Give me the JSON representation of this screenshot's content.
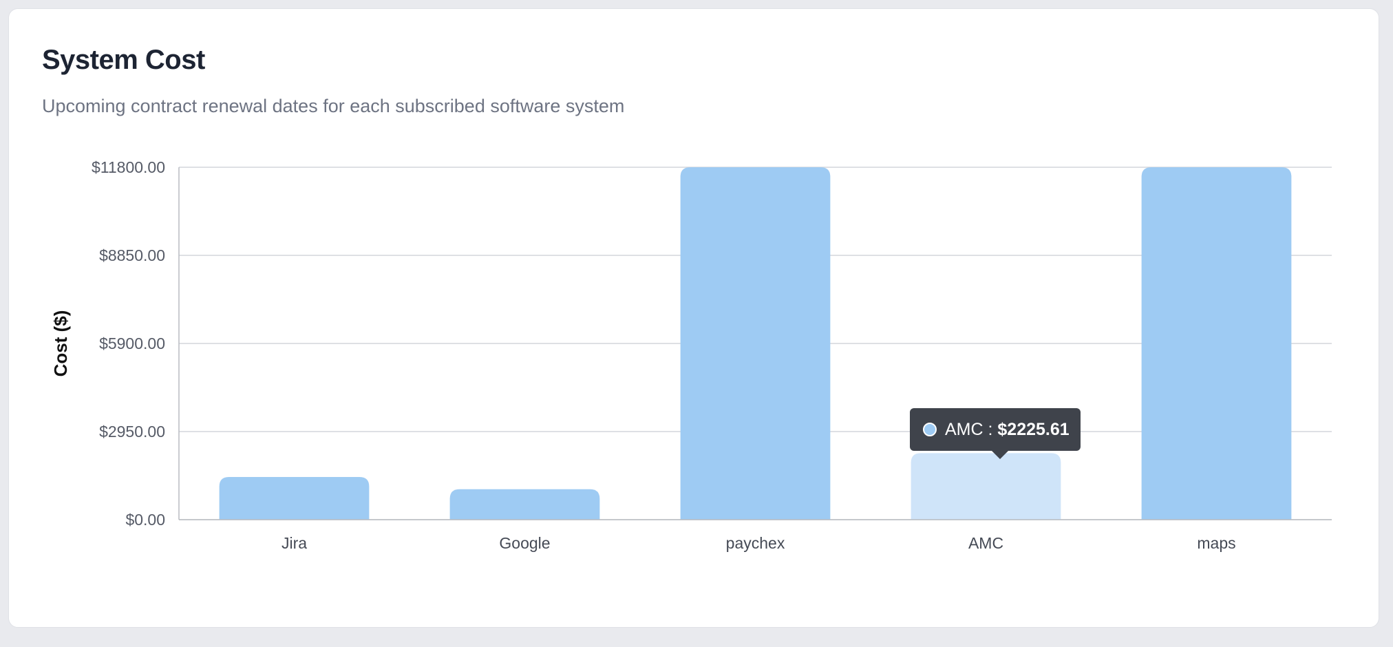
{
  "header": {
    "title": "System Cost",
    "subtitle": "Upcoming contract renewal dates for each subscribed software system"
  },
  "tooltip": {
    "series": "AMC",
    "separator": " : ",
    "value": "$2225.61",
    "color": "#9ecbf3"
  },
  "colors": {
    "bar": "#9ecbf3",
    "bar_highlight": "#cfe4f9",
    "grid": "#d4d6db",
    "axis": "#b9bcc2"
  },
  "chart_data": {
    "type": "bar",
    "title": "System Cost",
    "subtitle": "Upcoming contract renewal dates for each subscribed software system",
    "xlabel": "",
    "ylabel": "Cost ($)",
    "categories": [
      "Jira",
      "Google",
      "paychex",
      "AMC",
      "maps"
    ],
    "values": [
      1430,
      1020,
      11800,
      2225.61,
      11800
    ],
    "ylim": [
      0,
      11800
    ],
    "yticks": [
      0,
      2950,
      5900,
      8850,
      11800
    ],
    "ytick_labels": [
      "$0.00",
      "$2950.00",
      "$5900.00",
      "$8850.00",
      "$11800.00"
    ],
    "highlighted": "AMC",
    "grid": true,
    "legend": "none"
  }
}
